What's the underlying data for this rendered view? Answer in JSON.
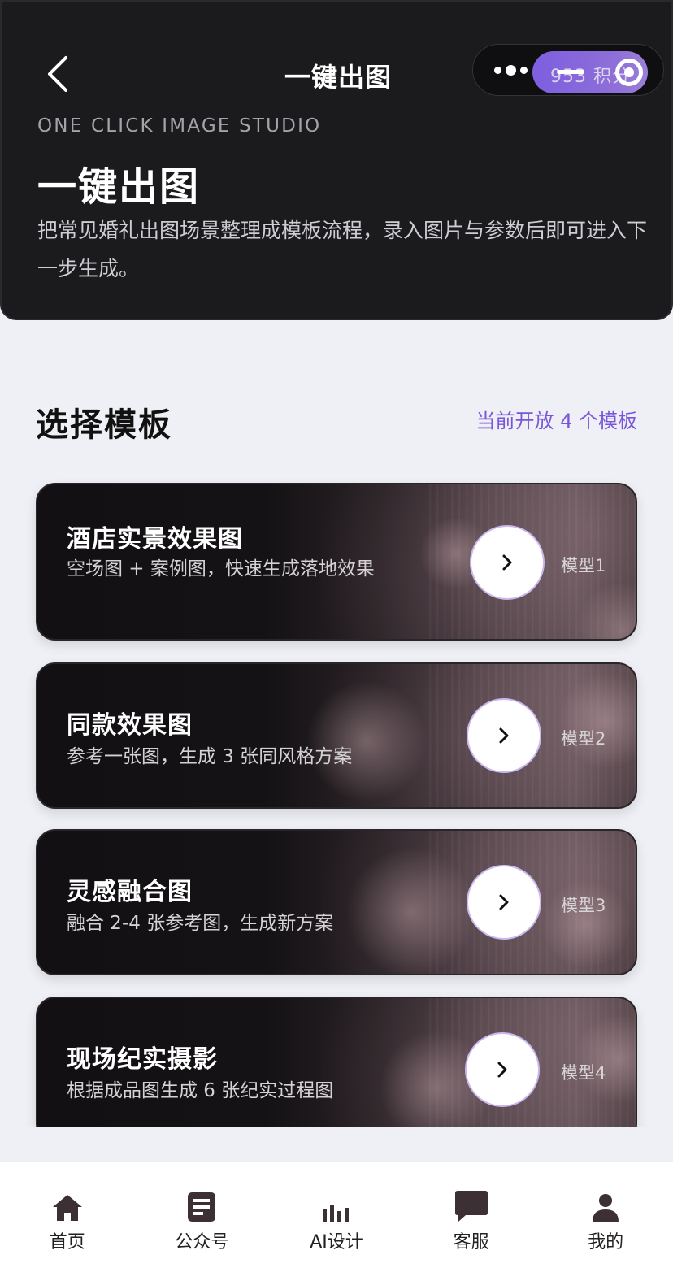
{
  "nav": {
    "title": "一键出图",
    "points_text": "953 积分"
  },
  "header": {
    "eyebrow": "ONE CLICK IMAGE STUDIO",
    "title": "一键出图",
    "description": "把常见婚礼出图场景整理成模板流程，录入图片与参数后即可进入下一步生成。"
  },
  "section": {
    "title": "选择模板",
    "count_text": "当前开放 4 个模板"
  },
  "templates": [
    {
      "title": "酒店实景效果图",
      "subtitle": "空场图 + 案例图，快速生成落地效果",
      "model": "模型1"
    },
    {
      "title": "同款效果图",
      "subtitle": "参考一张图，生成 3 张同风格方案",
      "model": "模型2"
    },
    {
      "title": "灵感融合图",
      "subtitle": "融合 2-4 张参考图，生成新方案",
      "model": "模型3"
    },
    {
      "title": "现场纪实摄影",
      "subtitle": "根据成品图生成 6 张纪实过程图",
      "model": "模型4"
    }
  ],
  "tabbar": {
    "items": [
      {
        "label": "首页",
        "icon": "home-icon"
      },
      {
        "label": "公众号",
        "icon": "article-icon"
      },
      {
        "label": "AI设计",
        "icon": "bar-chart-icon"
      },
      {
        "label": "客服",
        "icon": "chat-icon"
      },
      {
        "label": "我的",
        "icon": "user-icon"
      }
    ]
  },
  "colors": {
    "accent": "#7a55d9",
    "header_bg": "#1b1a1c",
    "page_bg": "#eef0f5"
  }
}
